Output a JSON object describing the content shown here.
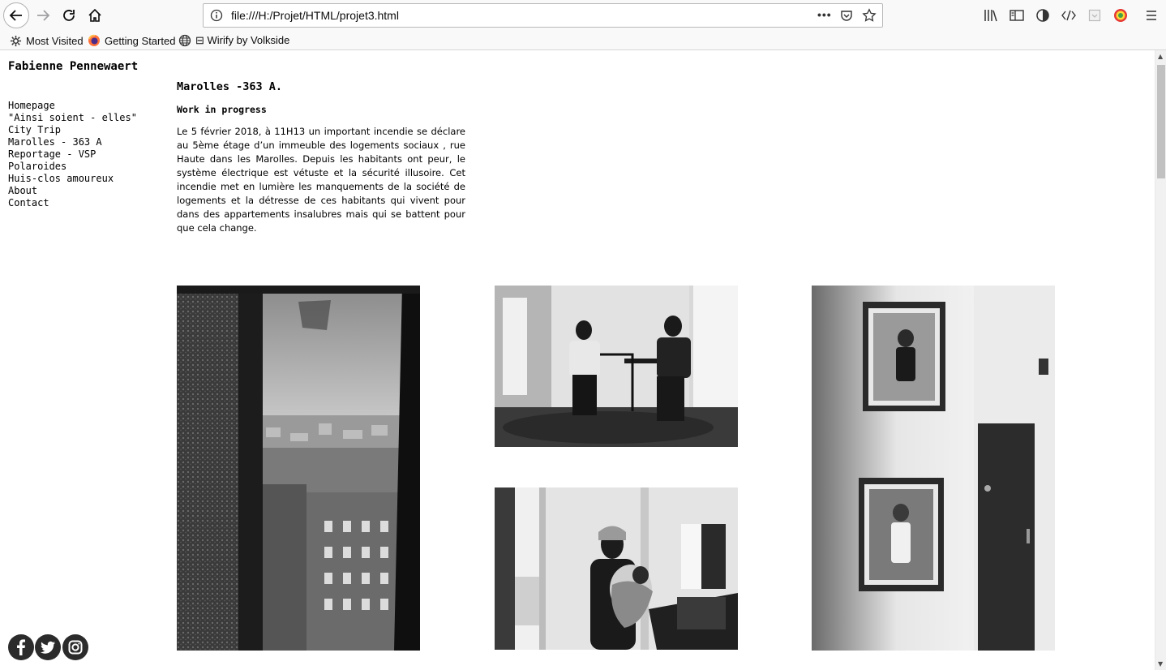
{
  "browser": {
    "url": "file:///H:/Projet/HTML/projet3.html",
    "more_label": "•••",
    "bookmarks": [
      {
        "label": "Most Visited",
        "icon": "gear-icon"
      },
      {
        "label": "Getting Started",
        "icon": "firefox-icon"
      },
      {
        "label": "⊟ Wirify by Volkside",
        "icon": "globe-icon"
      }
    ]
  },
  "site": {
    "title": "Fabienne Pennewaert",
    "nav": [
      "Homepage",
      "\"Ainsi soient - elles\"",
      "City Trip",
      "Marolles - 363 A",
      "Reportage - VSP",
      "Polaroides",
      "Huis-clos amoureux",
      "About",
      "Contact"
    ]
  },
  "article": {
    "title": "Marolles -363 A.",
    "subtitle": "Work in progress",
    "body": "Le 5 février 2018, à 11H13 un important incendie se déclare au 5ème étage d’un immeuble des logements sociaux , rue Haute dans les Marolles. Depuis les habitants ont peur, le système électrique est vétuste et la sécurité illusoire. Cet incendie met en lumière les manquements de la société de logements et la détresse de ces habitants qui vivent pour dans des appartements insalubres mais qui se battent pour que cela change."
  },
  "social": [
    "facebook-icon",
    "twitter-icon",
    "instagram-icon"
  ]
}
